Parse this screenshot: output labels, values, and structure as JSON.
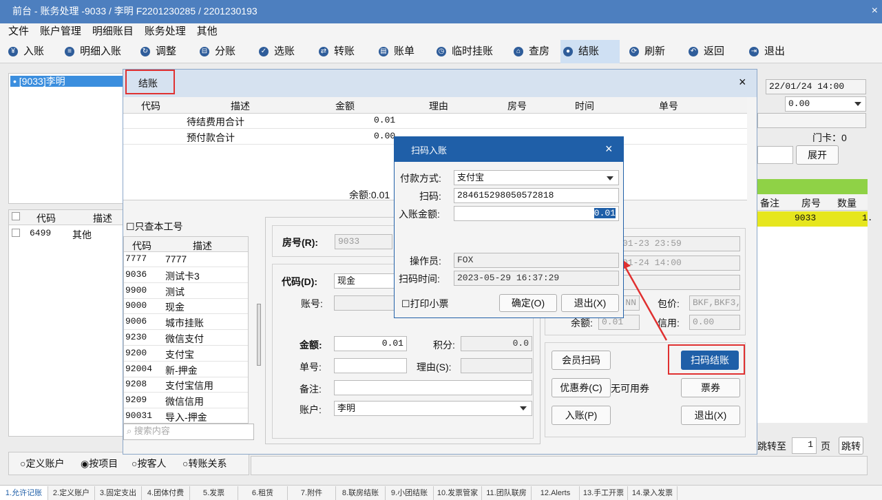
{
  "window": {
    "title": "前台 - 账务处理 -9033 / 李明 F2201230285 / 2201230193",
    "close": "×"
  },
  "menu": [
    "文件",
    "账户管理",
    "明细账目",
    "账务处理",
    "其他"
  ],
  "toolbar": [
    {
      "label": "入账",
      "icon": "yen-icon"
    },
    {
      "label": "明细入账",
      "icon": "list-icon"
    },
    {
      "label": "调整",
      "icon": "adjust-icon"
    },
    {
      "label": "分账",
      "icon": "split-icon"
    },
    {
      "label": "选账",
      "icon": "check-icon"
    },
    {
      "label": "转账",
      "icon": "transfer-icon"
    },
    {
      "label": "账单",
      "icon": "bill-icon"
    },
    {
      "label": "临时挂账",
      "icon": "clock-icon"
    },
    {
      "label": "查房",
      "icon": "house-icon"
    },
    {
      "label": "结账",
      "icon": "coins-icon"
    },
    {
      "label": "刷新",
      "icon": "refresh-icon"
    },
    {
      "label": "返回",
      "icon": "back-icon"
    },
    {
      "label": "退出",
      "icon": "exit-icon"
    }
  ],
  "left_tree": {
    "item": "[9033]李明"
  },
  "left_table": {
    "headers": [
      "代码",
      "描述"
    ],
    "rows": [
      [
        "6499",
        "其他"
      ]
    ]
  },
  "bg_right": {
    "datetime": "22/01/24 14:00",
    "amount": "0.00",
    "door_card": "门卡：0",
    "expand": "展开",
    "headers": [
      "备注",
      "房号",
      "数量"
    ],
    "row": [
      "",
      "9033",
      "1."
    ],
    "goto_label": "跳转至",
    "page": "1",
    "page_unit": "页",
    "goto_btn": "跳转"
  },
  "bottom_radios": [
    "定义账户",
    "按项目",
    "按客人",
    "转账关系"
  ],
  "bottom_tabs": [
    "1.允许记账",
    "2.定义账户",
    "3.固定支出",
    "4.团体付费",
    "5.发票",
    "6.租赁",
    "7.附件",
    "8.联房结账",
    "9.小团结账",
    "10.发票管家",
    "11.团队联房",
    "12.Alerts",
    "13.手工开票",
    "14.录入发票"
  ],
  "checkout": {
    "title": "结账",
    "close": "×",
    "headers": [
      "代码",
      "描述",
      "金额",
      "理由",
      "房号",
      "时间",
      "单号"
    ],
    "rows": [
      [
        "",
        "待结费用合计",
        "0.01"
      ],
      [
        "",
        "预付款合计",
        "0.00"
      ]
    ],
    "balance": "余额:0.01",
    "only_mine": "只查本工号",
    "code_headers": [
      "代码",
      "描述"
    ],
    "codes": [
      [
        "7777",
        "7777"
      ],
      [
        "9036",
        "测试卡3"
      ],
      [
        "9900",
        "测试"
      ],
      [
        "9000",
        "现金"
      ],
      [
        "9006",
        "城市挂账"
      ],
      [
        "9230",
        "微信支付"
      ],
      [
        "9200",
        "支付宝"
      ],
      [
        "92004",
        "新-押金"
      ],
      [
        "9208",
        "支付宝信用"
      ],
      [
        "9209",
        "微信信用"
      ],
      [
        "90031",
        "导入-押金"
      ]
    ],
    "search_placeholder": "搜索内容",
    "room_label": "房号(R):",
    "room": "9033",
    "code_label": "代码(D):",
    "code": "现金",
    "acct_label": "账号:",
    "amount_label": "金额:",
    "amount": "0.01",
    "points_label": "积分:",
    "points": "0.0",
    "no_label": "单号:",
    "reason_label": "理由(S):",
    "remark_label": "备注:",
    "account_label": "账户:",
    "account": "李明",
    "arrive": "01-23 23:59",
    "depart": "01-24 14:00",
    "nn": "NN",
    "package_label": "包价:",
    "package": "BKF,BKF3,(",
    "balance2_label": "余额:",
    "balance2": "0.01",
    "credit_label": "信用:",
    "credit": "0.00",
    "member_scan": "会员扫码",
    "scan_checkout": "扫码结账",
    "coupon": "优惠券(C)",
    "no_coupon": "无可用券",
    "ticket": "票券",
    "post": "入账(P)",
    "exit": "退出(X)"
  },
  "scan_dialog": {
    "title": "扫码入账",
    "close": "×",
    "pay_label": "付款方式:",
    "pay": "支付宝",
    "scan_label": "扫码:",
    "scan": "284615298050572818",
    "amt_label": "入账金额:",
    "amt": "0.01",
    "operator_label": "操作员:",
    "operator": "FOX",
    "time_label": "扫码时间:",
    "time": "2023-05-29 16:37:29",
    "print": "打印小票",
    "ok": "确定(O)",
    "cancel": "退出(X)"
  },
  "colors": {
    "titlebar": "#4d7fbf",
    "dialog_header": "#1f5fa8",
    "highlight": "#e6e61e",
    "annotation": "#e03030"
  }
}
